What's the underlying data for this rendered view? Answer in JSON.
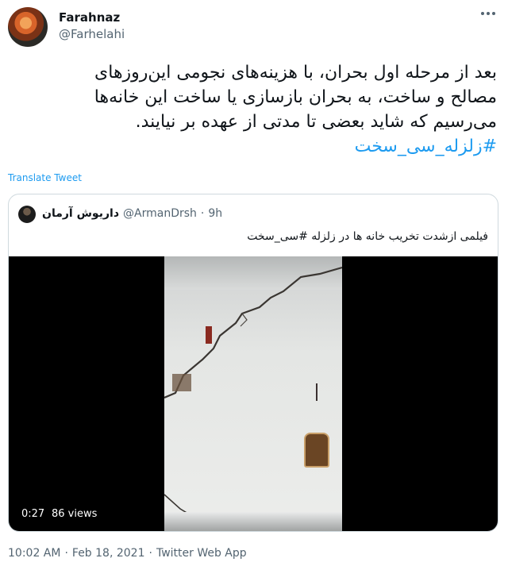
{
  "author": {
    "name": "Farahnaz",
    "handle": "@Farhelahi"
  },
  "tweet": {
    "text": "بعد از مرحله اول بحران، با هزینه‌های نجومی این‌روزهای\nمصالح و ساخت، به بحران بازسازی یا ساخت این خانه‌ها\nمی‌رسیم که شاید بعضی تا مدتی از عهده بر نیایند.",
    "hashtag": "#زلزله_سی_سخت",
    "translate_label": "Translate Tweet"
  },
  "quote": {
    "name": "داریوش آرمان",
    "handle": "@ArmanDrsh",
    "separator": "·",
    "time": "9h",
    "text": "فیلمی ازشدت تخریب خانه ها در زلزله #سی_سخت",
    "video": {
      "duration": "0:27",
      "views": "86 views"
    }
  },
  "footer": {
    "time": "10:02 AM",
    "separator1": "·",
    "date": "Feb 18, 2021",
    "separator2": "·",
    "source": "Twitter Web App"
  },
  "colors": {
    "link": "#1d9bf0",
    "secondary_text": "#536471",
    "border": "#cfd9de"
  },
  "icons": {
    "more": "more-horizontal-icon",
    "play": "video-player"
  }
}
